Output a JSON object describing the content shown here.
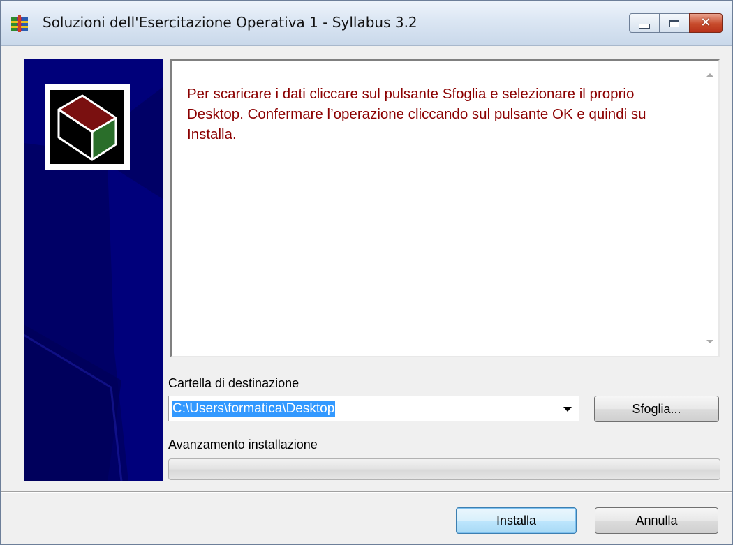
{
  "window": {
    "title": "Soluzioni dell'Esercitazione Operativa 1 - Syllabus 3.2",
    "app_icon": "installer-icon",
    "controls": {
      "minimize": "minimize-icon",
      "maximize": "maximize-icon",
      "close_glyph": "✕"
    }
  },
  "sidebar": {
    "logo": "package-box-icon"
  },
  "info": {
    "text": "Per scaricare i dati cliccare sul pulsante Sfoglia e selezionare il proprio Desktop. Confermare l’operazione cliccando sul pulsante OK e quindi su Installa."
  },
  "destination": {
    "label": "Cartella di destinazione",
    "value": "C:\\Users\\formatica\\Desktop",
    "browse_label": "Sfoglia..."
  },
  "progress": {
    "label": "Avanzamento installazione",
    "value": 0
  },
  "buttons": {
    "install_label": "Installa",
    "cancel_label": "Annulla"
  },
  "colors": {
    "sidebar": "#000066",
    "info_text": "#8b0000",
    "selection": "#3399ff",
    "close_button": "#c74a2b"
  }
}
